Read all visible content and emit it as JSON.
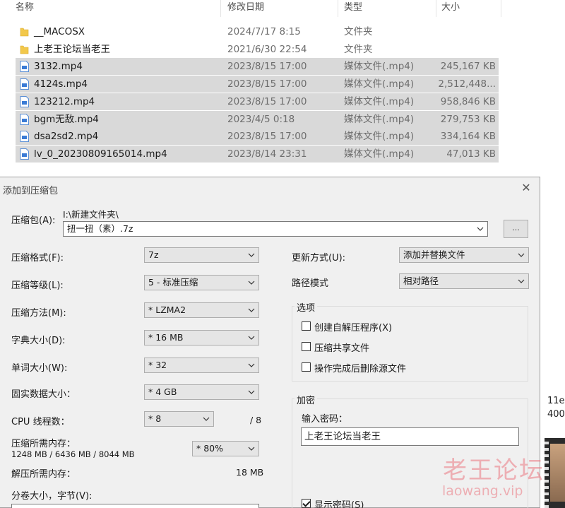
{
  "explorer": {
    "columns": {
      "name": "名称",
      "date": "修改日期",
      "type": "类型",
      "size": "大小"
    },
    "files": [
      {
        "name": "__MACOSX",
        "date": "2024/7/17 8:15",
        "type": "文件夹",
        "size": "",
        "kind": "folder"
      },
      {
        "name": "上老王论坛当老王",
        "date": "2021/6/30 22:54",
        "type": "文件夹",
        "size": "",
        "kind": "folder"
      },
      {
        "name": "3132.mp4",
        "date": "2023/8/15 17:00",
        "type": "媒体文件(.mp4)",
        "size": "245,167 KB",
        "kind": "video"
      },
      {
        "name": "4124s.mp4",
        "date": "2023/8/15 17:00",
        "type": "媒体文件(.mp4)",
        "size": "2,512,448...",
        "kind": "video"
      },
      {
        "name": "123212.mp4",
        "date": "2023/8/15 17:00",
        "type": "媒体文件(.mp4)",
        "size": "958,846 KB",
        "kind": "video"
      },
      {
        "name": "bgm无敌.mp4",
        "date": "2023/4/5 0:18",
        "type": "媒体文件(.mp4)",
        "size": "279,753 KB",
        "kind": "video"
      },
      {
        "name": "dsa2sd2.mp4",
        "date": "2023/8/15 17:00",
        "type": "媒体文件(.mp4)",
        "size": "334,164 KB",
        "kind": "video"
      },
      {
        "name": "lv_0_20230809165014.mp4",
        "date": "2023/8/14 23:31",
        "type": "媒体文件(.mp4)",
        "size": "47,013 KB",
        "kind": "video"
      }
    ]
  },
  "side_peek": {
    "line1": "11e",
    "line2": "400"
  },
  "dialog": {
    "title": "添加到压缩包",
    "close": "✕",
    "archive_label": "压缩包(A):",
    "archive_path": "I:\\新建文件夹\\",
    "archive_name": "扭一扭（素）.7z",
    "browse": "...",
    "format_label": "压缩格式(F):",
    "format_value": "7z",
    "level_label": "压缩等级(L):",
    "level_value": "5 - 标准压缩",
    "method_label": "压缩方法(M):",
    "method_value": "* LZMA2",
    "dict_label": "字典大小(D):",
    "dict_value": "* 16 MB",
    "word_label": "单词大小(W):",
    "word_value": "* 32",
    "solid_label": "固实数据大小：",
    "solid_value": "* 4 GB",
    "cpu_label": "CPU 线程数：",
    "cpu_value": "* 8",
    "cpu_max": "/ 8",
    "mem_label": "压缩所需内存：",
    "mem_detail": "1248 MB / 6436 MB / 8044 MB",
    "mem_value": "* 80%",
    "decomp_label": "解压所需内存：",
    "decomp_value": "18 MB",
    "split_label": "分卷大小，字节(V):",
    "update_label": "更新方式(U):",
    "update_value": "添加并替换文件",
    "path_label": "路径模式",
    "path_value": "相对路径",
    "options_title": "选项",
    "opt_sfx": "创建自解压程序(X)",
    "opt_shared": "压缩共享文件",
    "opt_delete": "操作完成后删除源文件",
    "encrypt_title": "加密",
    "password_label": "输入密码：",
    "password_value": "上老王论坛当老王",
    "show_password": "显示密码(S)"
  },
  "watermark": {
    "cn": "老王论坛",
    "en": "laowang.vip"
  },
  "colors": {
    "selection": "#d9d9d9",
    "folder": "#f2c84b",
    "video_icon": "#3a7bd5",
    "dialog_bg": "#f0f0f0"
  }
}
